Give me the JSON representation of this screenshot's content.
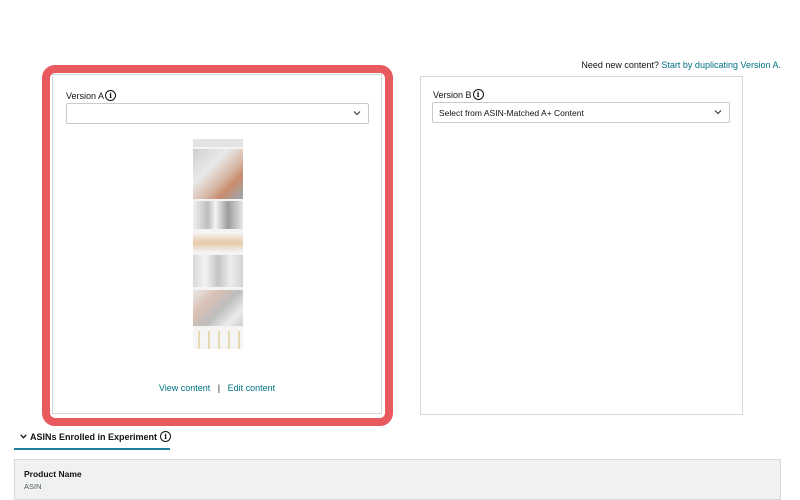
{
  "header": {
    "need_content_text": "Need new content?",
    "duplicate_link": "Start by duplicating Version A."
  },
  "version_a": {
    "label": "Version A",
    "select_value": "",
    "view_link": "View content",
    "separator": "|",
    "edit_link": "Edit content"
  },
  "version_b": {
    "label": "Version B",
    "select_value": "Select from ASIN-Matched A+ Content"
  },
  "asins_section": {
    "title": "ASINs Enrolled in Experiment"
  },
  "table": {
    "header_title": "Product Name",
    "header_subtitle": "ASIN"
  },
  "colors": {
    "highlight": "#e85a5e",
    "link": "#007185",
    "tab_underline": "#1e7e9a"
  },
  "icons": [
    "info-icon",
    "chevron-down-icon",
    "caret-down-icon"
  ]
}
